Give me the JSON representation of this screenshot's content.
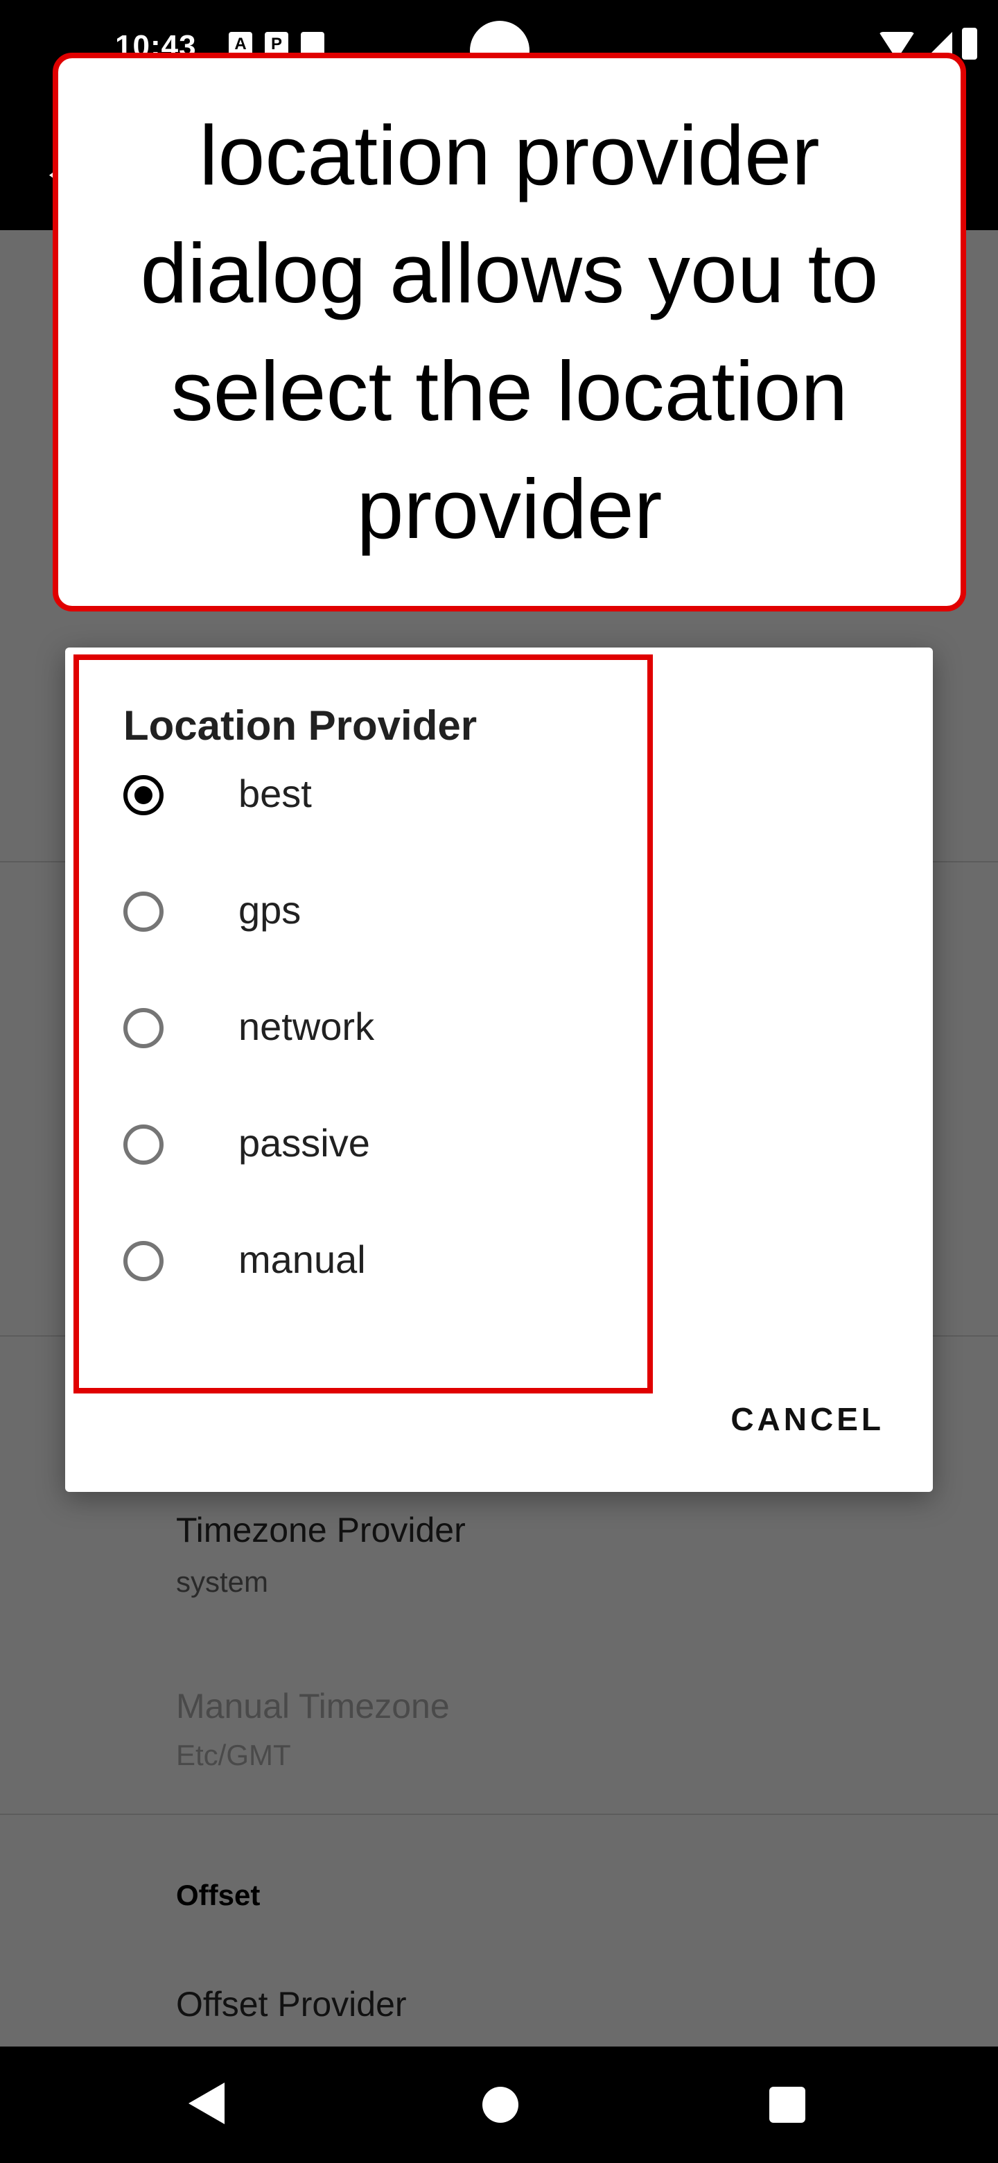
{
  "status_bar": {
    "time": "10:43"
  },
  "callout": {
    "text": "location provider dialog allows you to select the location provider"
  },
  "dialog": {
    "title": "Location Provider",
    "options": [
      {
        "label": "best",
        "selected": true
      },
      {
        "label": "gps",
        "selected": false
      },
      {
        "label": "network",
        "selected": false
      },
      {
        "label": "passive",
        "selected": false
      },
      {
        "label": "manual",
        "selected": false
      }
    ],
    "cancel_label": "CANCEL"
  },
  "settings": {
    "timezone_provider": {
      "title": "Timezone Provider",
      "value": "system"
    },
    "manual_timezone": {
      "title": "Manual Timezone",
      "value": "Etc/GMT"
    },
    "offset_header": "Offset",
    "offset_provider": {
      "title": "Offset Provider"
    }
  },
  "colors": {
    "highlight": "#e00000",
    "scrim": "#6b6b6b"
  }
}
